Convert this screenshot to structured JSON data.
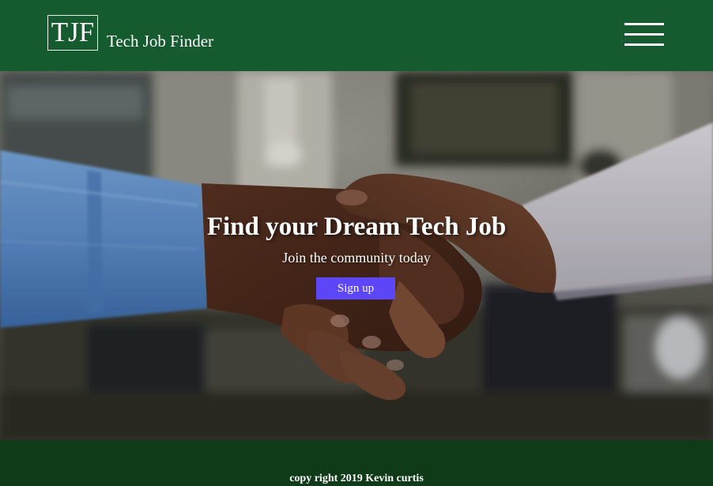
{
  "header": {
    "logo_text": "TJF",
    "brand_name": "Tech Job Finder",
    "menu_icon": "hamburger-menu-icon"
  },
  "hero": {
    "background_image": "handshake-photo",
    "title": "Find your Dream Tech Job",
    "subtitle": "Join the community today",
    "signup_label": "Sign up"
  },
  "footer": {
    "copyright": "copy right 2019 Kevin curtis"
  },
  "colors": {
    "header_bg": "#165b2f",
    "footer_bg": "#0f3b18",
    "button_bg": "#5d46f7",
    "text": "#ffffff"
  }
}
